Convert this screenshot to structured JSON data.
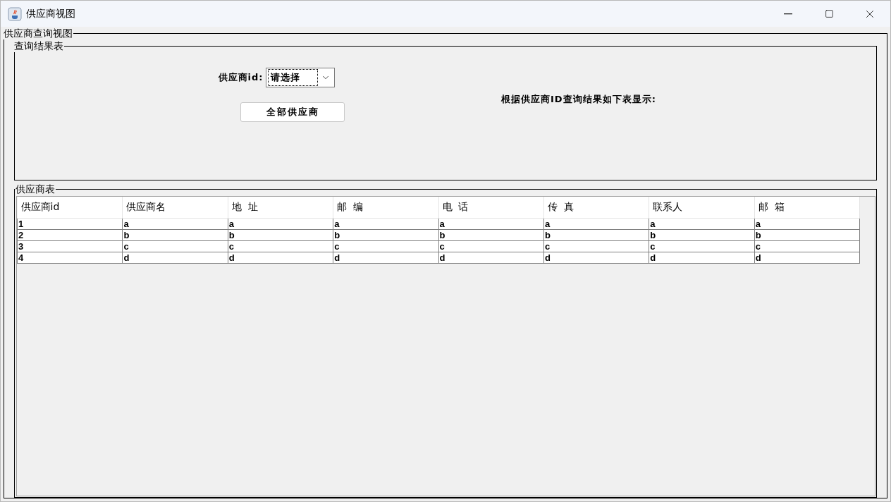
{
  "window": {
    "title": "供应商视图"
  },
  "outer_panel": {
    "title": "供应商查询视图"
  },
  "query_panel": {
    "title": "查询结果表",
    "id_label": "供应商id:",
    "id_select": {
      "value": "请选择"
    },
    "all_button": "全部供应商",
    "result_note": "根据供应商ID查询结果如下表显示:"
  },
  "table_panel": {
    "title": "供应商表",
    "table": {
      "columns": [
        "供应商id",
        "供应商名",
        "地  址",
        "邮  编",
        "电  话",
        "传  真",
        "联系人",
        "邮  箱"
      ],
      "rows": [
        [
          "1",
          "a",
          "a",
          "a",
          "a",
          "a",
          "a",
          "a"
        ],
        [
          "2",
          "b",
          "b",
          "b",
          "b",
          "b",
          "b",
          "b"
        ],
        [
          "3",
          "c",
          "c",
          "c",
          "c",
          "c",
          "c",
          "c"
        ],
        [
          "4",
          "d",
          "d",
          "d",
          "d",
          "d",
          "d",
          "d"
        ]
      ]
    }
  }
}
